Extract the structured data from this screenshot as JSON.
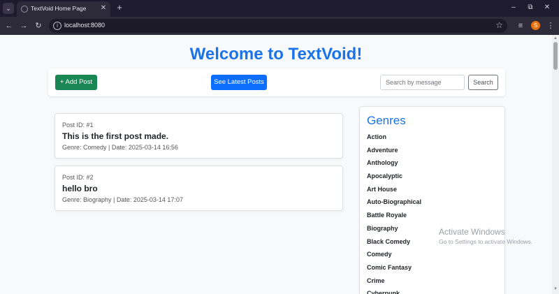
{
  "browser": {
    "tab_title": "TextVoid Home Page",
    "url": "localhost:8080",
    "profile_initial": "S"
  },
  "page": {
    "heading": "Welcome to TextVoid!",
    "toolbar": {
      "add_post_label": "+ Add Post",
      "latest_posts_label": "See Latest Posts",
      "search_placeholder": "Search by message",
      "search_value": "",
      "search_label": "Search"
    },
    "posts": [
      {
        "id": "Post ID: #1",
        "message": "This is the first post made.",
        "meta": "Genre: Comedy | Date: 2025-03-14 16:56"
      },
      {
        "id": "Post ID: #2",
        "message": "hello bro",
        "meta": "Genre: Biography | Date: 2025-03-14 17:07"
      }
    ],
    "genres": {
      "title": "Genres",
      "items": [
        "Action",
        "Adventure",
        "Anthology",
        "Apocalyptic",
        "Art House",
        "Auto-Biographical",
        "Battle Royale",
        "Biography",
        "Black Comedy",
        "Comedy",
        "Comic Fantasy",
        "Crime",
        "Cyberpunk"
      ]
    }
  },
  "os_overlay": {
    "activate_title": "Activate Windows",
    "activate_sub": "Go to Settings to activate Windows."
  },
  "colors": {
    "brand_blue": "#1a73e8",
    "add_button": "#198754",
    "latest_button": "#0d6efd",
    "browser_frame": "#1f1b2e",
    "profile": "#e8710a"
  },
  "icons": [
    "tab-search-icon",
    "favicon-icon",
    "close-icon",
    "plus-icon",
    "minimize-icon",
    "restore-icon",
    "back-icon",
    "forward-icon",
    "reload-icon",
    "site-info-icon",
    "star-icon",
    "media-icon",
    "menu-icon"
  ]
}
